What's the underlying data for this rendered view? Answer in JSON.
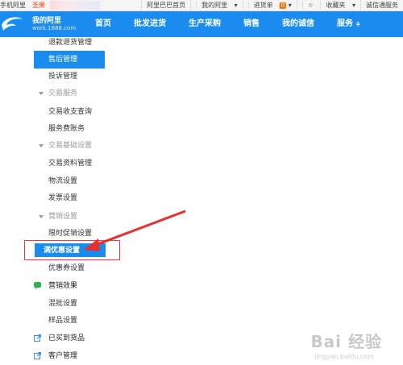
{
  "topbar": {
    "left_label": "手机阿里",
    "promo": "圣果",
    "links": [
      "阿里巴巴首页",
      "我的阿里",
      "进货单",
      "收藏夹",
      "诚信通服务"
    ],
    "cart_count": "0"
  },
  "brand": {
    "title": "我的阿里",
    "subtitle": "work.1688.com"
  },
  "nav": [
    "首页",
    "批发进货",
    "生产采购",
    "销售",
    "我的诚信",
    "服务"
  ],
  "sidebar": {
    "items": [
      {
        "type": "sub",
        "label": "退款退货管理"
      },
      {
        "type": "selected",
        "label": "售后管理"
      },
      {
        "type": "sub",
        "label": "投诉管理"
      },
      {
        "type": "group",
        "label": "交易服务"
      },
      {
        "type": "sub",
        "label": "交易收支查询"
      },
      {
        "type": "sub",
        "label": "服务费账务"
      },
      {
        "type": "group",
        "label": "交易基础设置"
      },
      {
        "type": "sub",
        "label": "交易资料管理"
      },
      {
        "type": "sub",
        "label": "物流设置"
      },
      {
        "type": "sub",
        "label": "发票设置"
      },
      {
        "type": "group",
        "label": "营销设置"
      },
      {
        "type": "sub",
        "label": "限时促销设置"
      },
      {
        "type": "highlight",
        "label": "满优惠设置"
      },
      {
        "type": "sub",
        "label": "优惠券设置"
      },
      {
        "type": "main",
        "label": "营销效果",
        "icon": "chat-icon"
      },
      {
        "type": "sub",
        "label": "混批设置"
      },
      {
        "type": "sub",
        "label": "样品设置"
      },
      {
        "type": "main",
        "label": "已买到货品",
        "icon": "external-link-icon"
      },
      {
        "type": "main",
        "label": "客户管理",
        "icon": "external-link-icon"
      }
    ]
  },
  "watermark": {
    "text": "Bai 经验",
    "sub": "jingyan.baidu.com"
  },
  "colors": {
    "nav_blue": "#1a8cf0",
    "highlight_red": "#e63c3c",
    "arrow_red": "#e8302e"
  }
}
